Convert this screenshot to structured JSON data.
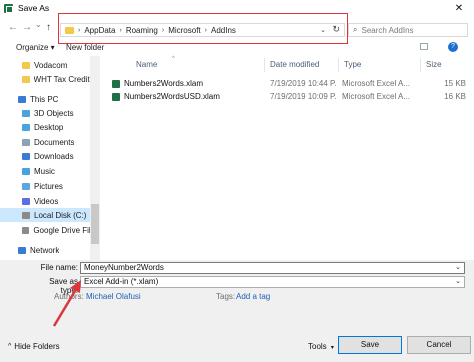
{
  "window": {
    "title": "Save As",
    "close_glyph": "✕"
  },
  "nav": {
    "back_glyph": "←",
    "forward_glyph": "→",
    "recent_glyph": "⌄",
    "up_glyph": "↑",
    "breadcrumb": [
      "AppData",
      "Roaming",
      "Microsoft",
      "AddIns"
    ],
    "separator": "›",
    "dropdown_glyph": "⌄",
    "refresh_glyph": "↻",
    "search_placeholder": "Search AddIns",
    "search_glyph": "⌕"
  },
  "toolbar": {
    "organize_label": "Organize ▾",
    "new_folder_label": "New folder",
    "help_glyph": "?"
  },
  "sidebar": {
    "items": [
      {
        "label": "Vodacom",
        "icon": "folder-icon",
        "color": "#f2c94c"
      },
      {
        "label": "WHT Tax Credits",
        "icon": "folder-icon",
        "color": "#f2c94c"
      },
      {
        "label": "This PC",
        "icon": "computer-icon",
        "color": "#3a7bd5"
      },
      {
        "label": "3D Objects",
        "icon": "cube-icon",
        "color": "#4aa3df"
      },
      {
        "label": "Desktop",
        "icon": "desktop-icon",
        "color": "#4aa3df"
      },
      {
        "label": "Documents",
        "icon": "documents-icon",
        "color": "#8ea1b5"
      },
      {
        "label": "Downloads",
        "icon": "download-icon",
        "color": "#3a7bd5"
      },
      {
        "label": "Music",
        "icon": "music-icon",
        "color": "#4aa3df"
      },
      {
        "label": "Pictures",
        "icon": "pictures-icon",
        "color": "#5da7df"
      },
      {
        "label": "Videos",
        "icon": "video-icon",
        "color": "#5d6fdf"
      },
      {
        "label": "Local Disk (C:)",
        "icon": "disk-icon",
        "color": "#8a8a8a"
      },
      {
        "label": "Google Drive File",
        "icon": "disk-icon",
        "color": "#8a8a8a"
      },
      {
        "label": "Network",
        "icon": "network-icon",
        "color": "#3a7bd5"
      }
    ]
  },
  "files": {
    "columns": {
      "name": "Name",
      "date": "Date modified",
      "type": "Type",
      "size": "Size"
    },
    "sort_glyph": "^",
    "rows": [
      {
        "name": "Numbers2Words.xlam",
        "date": "7/19/2019 10:44 P...",
        "type": "Microsoft Excel A...",
        "size": "15 KB"
      },
      {
        "name": "Numbers2WordsUSD.xlam",
        "date": "7/19/2019 10:09 P...",
        "type": "Microsoft Excel A...",
        "size": "16 KB"
      }
    ]
  },
  "form": {
    "file_name_label": "File name:",
    "file_name_value": "MoneyNumber2Words",
    "save_as_type_label": "Save as type:",
    "save_as_type_value": "Excel Add-in (*.xlam)",
    "authors_label": "Authors:",
    "authors_value": "Michael Olafusi",
    "tags_label": "Tags:",
    "tags_value": "Add a tag",
    "dropdown_glyph": "⌄"
  },
  "footer": {
    "hide_folders_label": "Hide Folders",
    "hide_glyph": "^",
    "tools_label": "Tools",
    "tools_glyph": "▾",
    "save_label": "Save",
    "cancel_label": "Cancel"
  },
  "colors": {
    "highlight": "#d9363e",
    "link": "#1f5fb8",
    "selection": "#cce8ff",
    "excel_green": "#1e7145"
  }
}
